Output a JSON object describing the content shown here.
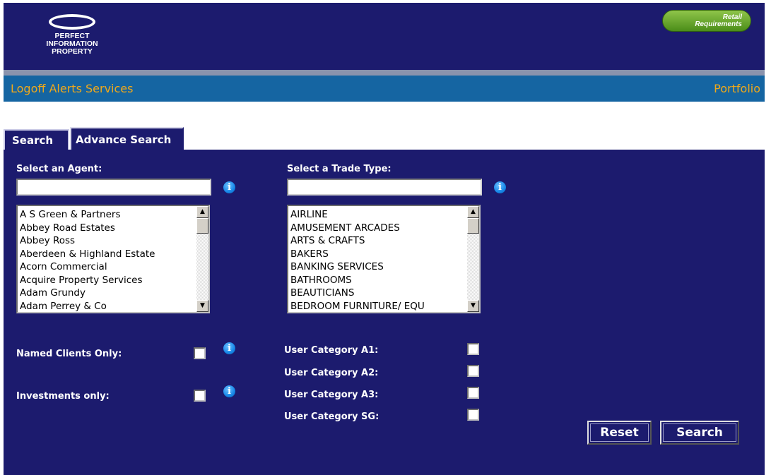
{
  "header": {
    "logo_lines": [
      "PERFECT",
      "INFORMATION",
      "PROPERTY"
    ],
    "retail_button_lines": [
      "Retail",
      "Requirements"
    ]
  },
  "nav": {
    "left_items": [
      "Logoff",
      "Alerts",
      "Services"
    ],
    "right_item": "Portfolio"
  },
  "tabs": {
    "search": "Search",
    "advance_search": "Advance Search"
  },
  "form": {
    "agent_label": "Select an Agent:",
    "agent_filter_value": "",
    "agents": [
      "A S Green & Partners",
      "Abbey Road Estates",
      "Abbey Ross",
      "Aberdeen & Highland Estate",
      "Acorn Commercial",
      "Acquire Property Services",
      "Adam Grundy",
      "Adam Perrey & Co"
    ],
    "trade_label": "Select a Trade Type:",
    "trade_filter_value": "",
    "trade_types": [
      "AIRLINE",
      "AMUSEMENT ARCADES",
      "ARTS & CRAFTS",
      "BAKERS",
      "BANKING SERVICES",
      "BATHROOMS",
      "BEAUTICIANS",
      "BEDROOM FURNITURE/ EQU"
    ],
    "named_clients_label": "Named Clients Only:",
    "investments_label": "Investments only:",
    "user_categories": [
      "User Category A1:",
      "User Category A2:",
      "User Category A3:",
      "User Category SG:"
    ],
    "reset_label": "Reset",
    "search_label": "Search",
    "info_glyph": "i"
  },
  "colors": {
    "panel": "#1c1b6e",
    "navbar": "#1565a2",
    "nav_text": "#f0a81a",
    "retail_button": "#6aa82f"
  },
  "icons": {
    "info": "info-icon",
    "scroll_up": "▲",
    "scroll_down": "▼"
  }
}
